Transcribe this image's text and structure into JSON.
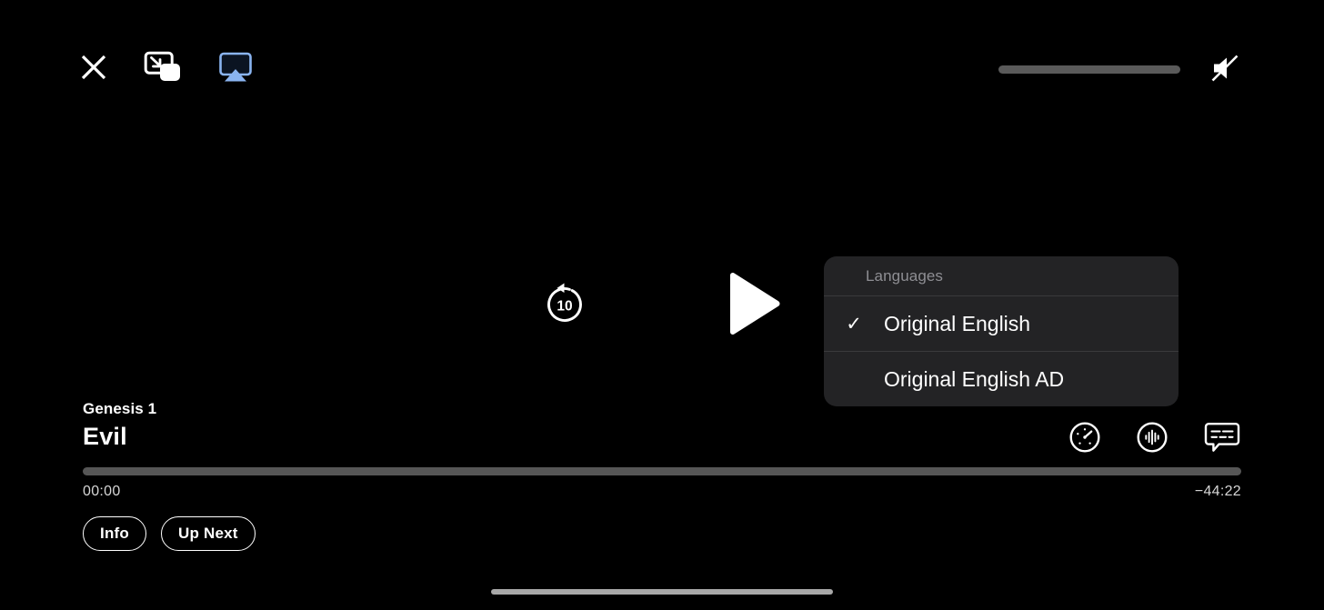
{
  "player": {
    "background_color": "#000000",
    "top_bar": {
      "close_label": "close-icon",
      "pip_label": "picture-in-picture-icon",
      "airplay_label": "airplay-icon",
      "airplay_color": "#8ab4f0",
      "volume": {
        "level_percent": 0,
        "muted": true,
        "mute_icon": "speaker-slash-icon"
      }
    },
    "transport": {
      "skip_back_seconds": "10",
      "skip_back_icon": "skip-back-10-icon",
      "play_icon": "play-icon",
      "state": "paused"
    },
    "languages_menu": {
      "header": "Languages",
      "items": [
        {
          "label": "Original English",
          "selected": true,
          "check": "✓"
        },
        {
          "label": "Original English AD",
          "selected": false,
          "check": "✓"
        }
      ]
    },
    "now_playing": {
      "episode": "Genesis 1",
      "show": "Evil"
    },
    "settings_icons": [
      {
        "name": "playback-speed-icon",
        "label": "Playback Speed"
      },
      {
        "name": "audio-icon",
        "label": "Audio"
      },
      {
        "name": "subtitles-icon",
        "label": "Subtitles"
      }
    ],
    "scrubber": {
      "progress_percent": 0,
      "elapsed": "00:00",
      "remaining": "−44:22",
      "track_color": "#565656"
    },
    "pills": [
      {
        "label": "Info",
        "name": "info-button"
      },
      {
        "label": "Up Next",
        "name": "up-next-button"
      }
    ],
    "home_indicator": "home-indicator"
  }
}
